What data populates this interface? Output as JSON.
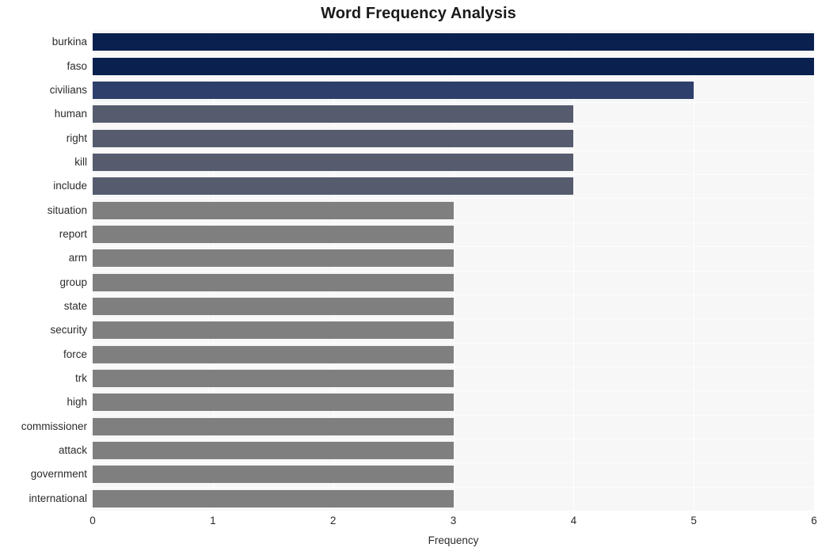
{
  "chart_data": {
    "type": "bar",
    "orientation": "horizontal",
    "title": "Word Frequency Analysis",
    "xlabel": "Frequency",
    "ylabel": "",
    "xlim": [
      0,
      6
    ],
    "xticks": [
      0,
      1,
      2,
      3,
      4,
      5,
      6
    ],
    "xtick_labels": [
      "0",
      "1",
      "2",
      "3",
      "4",
      "5",
      "6"
    ],
    "grid": true,
    "legend": "none",
    "categories": [
      "burkina",
      "faso",
      "civilians",
      "human",
      "right",
      "kill",
      "include",
      "situation",
      "report",
      "arm",
      "group",
      "state",
      "security",
      "force",
      "trk",
      "high",
      "commissioner",
      "attack",
      "government",
      "international"
    ],
    "values": [
      6,
      6,
      5,
      4,
      4,
      4,
      4,
      3,
      3,
      3,
      3,
      3,
      3,
      3,
      3,
      3,
      3,
      3,
      3,
      3
    ],
    "bar_colors": [
      "#0a2150",
      "#0a2150",
      "#2e3f6b",
      "#565c6e",
      "#565c6e",
      "#565c6e",
      "#565c6e",
      "#7f7f7f",
      "#7f7f7f",
      "#7f7f7f",
      "#7f7f7f",
      "#7f7f7f",
      "#7f7f7f",
      "#7f7f7f",
      "#7f7f7f",
      "#7f7f7f",
      "#7f7f7f",
      "#7f7f7f",
      "#7f7f7f",
      "#7f7f7f"
    ],
    "plot_background": "#f7f7f7",
    "gridline_color": "#ffffff",
    "figure_background": "#ffffff"
  }
}
